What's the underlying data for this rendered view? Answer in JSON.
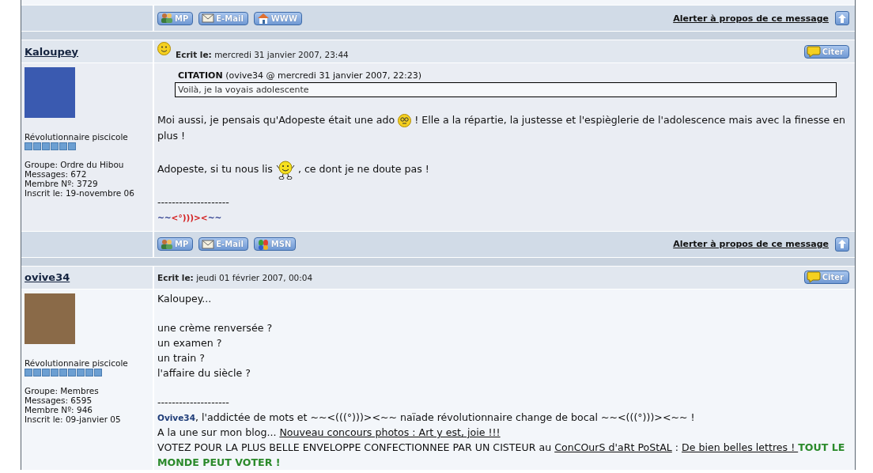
{
  "previous_post_footer": {
    "buttons": [
      {
        "kind": "pm",
        "label": "MP"
      },
      {
        "kind": "email",
        "label": "E-Mail"
      },
      {
        "kind": "www",
        "label": "WWW"
      }
    ],
    "alert": "Alerter à propos de ce message"
  },
  "posts": [
    {
      "author": "Kaloupey",
      "smiley": true,
      "date_label": "Ecrit le:",
      "date": "mercredi 31 janvier 2007, 23:44",
      "quote_button": "Citer",
      "rank": "Révolutionnaire piscicole",
      "stars": 6,
      "details": [
        "Groupe: Ordre du Hibou",
        "Messages: 672",
        "Membre Nº: 3729",
        "Inscrit le: 19-novembre 06"
      ],
      "body": [
        {
          "kind": "quote",
          "label": "CITATION",
          "meta": "(ovive34 @ mercredi 31 janvier 2007, 22:23)",
          "text": "Voilà, je la voyais adolescente"
        },
        {
          "kind": "blank"
        },
        {
          "kind": "line",
          "segments": [
            {
              "kind": "text",
              "text": "Moi aussi, je pensais qu'Adopeste était une ado "
            },
            {
              "kind": "emoticon"
            },
            {
              "kind": "text",
              "text": " ! Elle a la répartie, la justesse et l'espièglerie de l'adolescence mais avec la finesse en plus !"
            }
          ]
        },
        {
          "kind": "blank"
        },
        {
          "kind": "line",
          "segments": [
            {
              "kind": "text",
              "text": "Adopeste, si tu nous lis "
            },
            {
              "kind": "dancer"
            },
            {
              "kind": "text",
              "text": " , ce dont je ne doute pas !"
            }
          ]
        },
        {
          "kind": "blank"
        },
        {
          "kind": "line",
          "segments": [
            {
              "kind": "text",
              "text": "--------------------"
            }
          ]
        },
        {
          "kind": "line",
          "segments": [
            {
              "kind": "small",
              "text": "~~",
              "color": "#2a3a8c"
            },
            {
              "kind": "small",
              "text": "<°)))><",
              "color": "#d42020"
            },
            {
              "kind": "small",
              "text": "~~",
              "color": "#2a3a8c"
            }
          ]
        }
      ],
      "footer": {
        "buttons": [
          {
            "kind": "pm",
            "label": "MP"
          },
          {
            "kind": "email",
            "label": "E-Mail"
          },
          {
            "kind": "msn",
            "label": "MSN"
          }
        ],
        "alert": "Alerter à propos de ce message"
      }
    },
    {
      "author": "ovive34",
      "date_label": "Ecrit le:",
      "date": "jeudi 01 février 2007, 00:04",
      "quote_button": "Citer",
      "rank": "Révolutionnaire piscicole",
      "stars": 9,
      "details": [
        "Groupe: Membres",
        "Messages: 6595",
        "Membre Nº: 946",
        "Inscrit le: 09-janvier 05"
      ],
      "body": [
        {
          "kind": "line",
          "segments": [
            {
              "kind": "text",
              "text": "Kaloupey..."
            }
          ]
        },
        {
          "kind": "blank"
        },
        {
          "kind": "line",
          "segments": [
            {
              "kind": "text",
              "text": "une crème renversée ?"
            }
          ]
        },
        {
          "kind": "line",
          "segments": [
            {
              "kind": "text",
              "text": "un examen ?"
            }
          ]
        },
        {
          "kind": "line",
          "segments": [
            {
              "kind": "text",
              "text": "un train ?"
            }
          ]
        },
        {
          "kind": "line",
          "segments": [
            {
              "kind": "text",
              "text": "l'affaire du siècle ?"
            }
          ]
        },
        {
          "kind": "blank"
        },
        {
          "kind": "line",
          "segments": [
            {
              "kind": "text",
              "text": "--------------------"
            }
          ]
        },
        {
          "kind": "line",
          "segments": [
            {
              "kind": "small",
              "text": "Ovive34",
              "color": "#1e3c78"
            },
            {
              "kind": "text",
              "text": ", l'addictée de mots et ~~<(((°)))><~~ naïade révolutionnaire change de bocal ~~<(((°)))><~~ !"
            }
          ]
        },
        {
          "kind": "line",
          "segments": [
            {
              "kind": "text",
              "text": "A la une sur mon blog... "
            },
            {
              "kind": "link",
              "text": "Nouveau concours photos : Art y est, joie !!!"
            }
          ]
        },
        {
          "kind": "line",
          "segments": [
            {
              "kind": "text",
              "text": "VOTEZ POUR LA PLUS BELLE ENVELOPPE CONFECTIONNEE PAR UN CISTEUR au "
            },
            {
              "kind": "link",
              "text": "ConCOurS d'aRt PoStAL"
            },
            {
              "kind": "text",
              "text": " : "
            },
            {
              "kind": "link",
              "text": "De bien belles lettres ! "
            },
            {
              "kind": "strong",
              "text": "TOUT LE MONDE PEUT VOTER !",
              "color": "#2b8a2b"
            }
          ]
        }
      ]
    }
  ]
}
